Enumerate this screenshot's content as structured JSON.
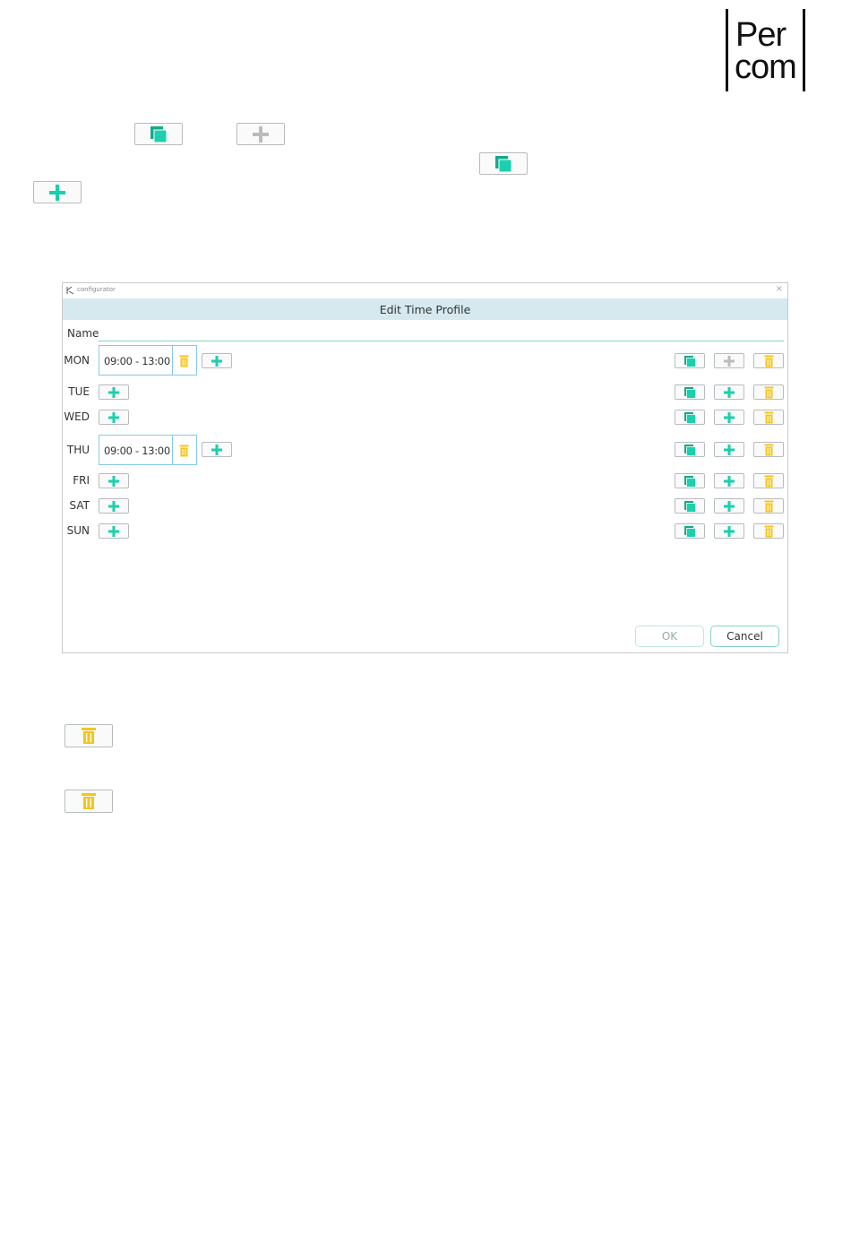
{
  "logo": {
    "line1": "Per",
    "line2": "com"
  },
  "colors": {
    "accent": "#1ccfae",
    "trash": "#f4c51d",
    "disabled": "#bbbbbb",
    "header_bg": "#d5e9ef"
  },
  "dialog": {
    "app_title": "configurator",
    "close_glyph": "×",
    "title": "Edit Time Profile",
    "name_label": "Name",
    "name_value": "",
    "days": [
      {
        "label": "MON",
        "slot": "09:00 - 13:00"
      },
      {
        "label": "TUE",
        "slot": ""
      },
      {
        "label": "WED",
        "slot": ""
      },
      {
        "label": "THU",
        "slot": "09:00 - 13:00"
      },
      {
        "label": "FRI",
        "slot": ""
      },
      {
        "label": "SAT",
        "slot": ""
      },
      {
        "label": "SUN",
        "slot": ""
      }
    ],
    "ok_label": "OK",
    "cancel_label": "Cancel"
  },
  "icons": {
    "copy": "copy-icon",
    "add": "plus-icon",
    "delete": "trash-icon"
  }
}
